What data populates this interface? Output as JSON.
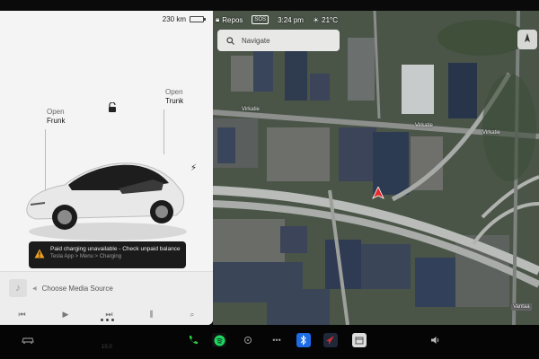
{
  "status": {
    "range": "230 km",
    "mode": "Repos",
    "time": "3:24 pm",
    "temp": "21°C",
    "chip_label": "SOS"
  },
  "car": {
    "frunk_state": "Open",
    "frunk_label": "Frunk",
    "trunk_state": "Open",
    "trunk_label": "Trunk"
  },
  "alert": {
    "title": "Paid charging unavailable - Check unpaid balance",
    "subtitle": "Tesla App > Menu > Charging"
  },
  "media": {
    "source_label": "Choose Media Source"
  },
  "map": {
    "search_placeholder": "Navigate",
    "streets": [
      "Virkatie",
      "Virkatie",
      "Virkatie"
    ],
    "badge": "Vantaa"
  },
  "bottom": {
    "left_temp": "15.0"
  },
  "colors": {
    "accent_red": "#e52b2b",
    "spotify_green": "#1ed760",
    "phone_green": "#2ecc40",
    "bluetooth_blue": "#1e6be6"
  },
  "icons": [
    "battery-icon",
    "lock-icon",
    "bolt-icon",
    "warning-icon",
    "music-note-icon",
    "search-icon",
    "phone-icon",
    "spotify-icon",
    "bluetooth-icon",
    "navigation-icon",
    "volume-icon",
    "car-icon"
  ]
}
